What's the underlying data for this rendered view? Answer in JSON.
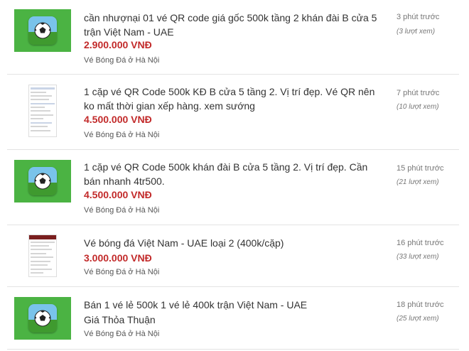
{
  "listings": [
    {
      "title": "cần nhượnại 01 vé QR code giá gốc 500k tầng 2 khán đài B cửa 5 trận Việt Nam - UAE",
      "price": "2.900.000 VNĐ",
      "location": "Vé Bóng Đá ở Hà Nội",
      "time": "3 phút trước",
      "views": "(3 lượt xem)",
      "thumbnail_icon": "soccer-ball-app-icon"
    },
    {
      "title": "1 cặp vé QR Code 500k KĐ B cửa 5 tầng 2. Vị trí đẹp. Vé QR nên ko mất thời gian xếp hàng. xem sướng",
      "price": "4.500.000 VNĐ",
      "location": "Vé Bóng Đá ở Hà Nội",
      "time": "7 phút trước",
      "views": "(10 lượt xem)",
      "thumbnail_icon": "document-screenshot-thumbnail"
    },
    {
      "title": "1 cặp vé QR Code 500k khán đài B cửa 5 tầng 2. Vị trí đẹp. Cần bán nhanh 4tr500.",
      "price": "4.500.000 VNĐ",
      "location": "Vé Bóng Đá ở Hà Nội",
      "time": "15 phút trước",
      "views": "(21 lượt xem)",
      "thumbnail_icon": "soccer-ball-app-icon"
    },
    {
      "title": "Vé bóng đá Việt Nam - UAE loại 2 (400k/cặp)",
      "price": "3.000.000 VNĐ",
      "location": "Vé Bóng Đá ở Hà Nội",
      "time": "16 phút trước",
      "views": "(33 lượt xem)",
      "thumbnail_icon": "webpage-screenshot-thumbnail"
    },
    {
      "title": "Bán 1 vé lẻ 500k 1 vé lẻ 400k trận Việt Nam - UAE",
      "price": "Giá Thỏa Thuận",
      "location": "Vé Bóng Đá ở Hà Nội",
      "time": "18 phút trước",
      "views": "(25 lượt xem)",
      "thumbnail_icon": "soccer-ball-app-icon"
    }
  ],
  "colors": {
    "price": "#c22a2a",
    "thumbnail_green": "#4bb343",
    "divider": "#e3e3e3"
  }
}
